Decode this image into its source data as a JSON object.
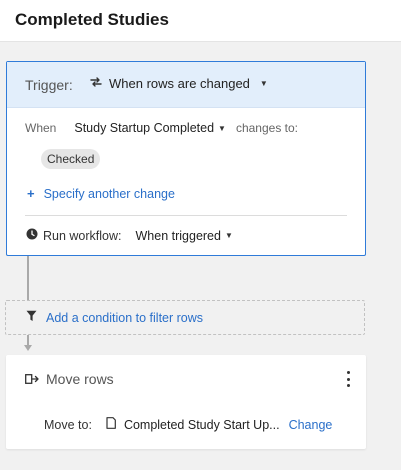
{
  "header": {
    "title": "Completed Studies"
  },
  "trigger": {
    "label": "Trigger:",
    "event": "When rows are changed",
    "when_label": "When",
    "field": "Study Startup Completed",
    "changes_to": "changes to:",
    "value_chip": "Checked",
    "specify_link": "Specify another change",
    "run_label": "Run workflow:",
    "run_value": "When triggered"
  },
  "filter": {
    "link": "Add a condition to filter rows"
  },
  "action": {
    "title": "Move rows",
    "move_to_label": "Move to:",
    "destination": "Completed Study Start Up...",
    "change_link": "Change"
  },
  "colors": {
    "accent": "#2f7bd9",
    "link": "#2a6fc9",
    "trigger_header_bg": "#e2eefb"
  },
  "icons": {
    "trigger_event": "rows-changed-icon",
    "specify": "plus-icon",
    "run": "clock-icon",
    "filter": "filter-icon",
    "action": "move-rows-icon",
    "menu": "kebab-menu-icon",
    "destination": "sheet-icon"
  }
}
